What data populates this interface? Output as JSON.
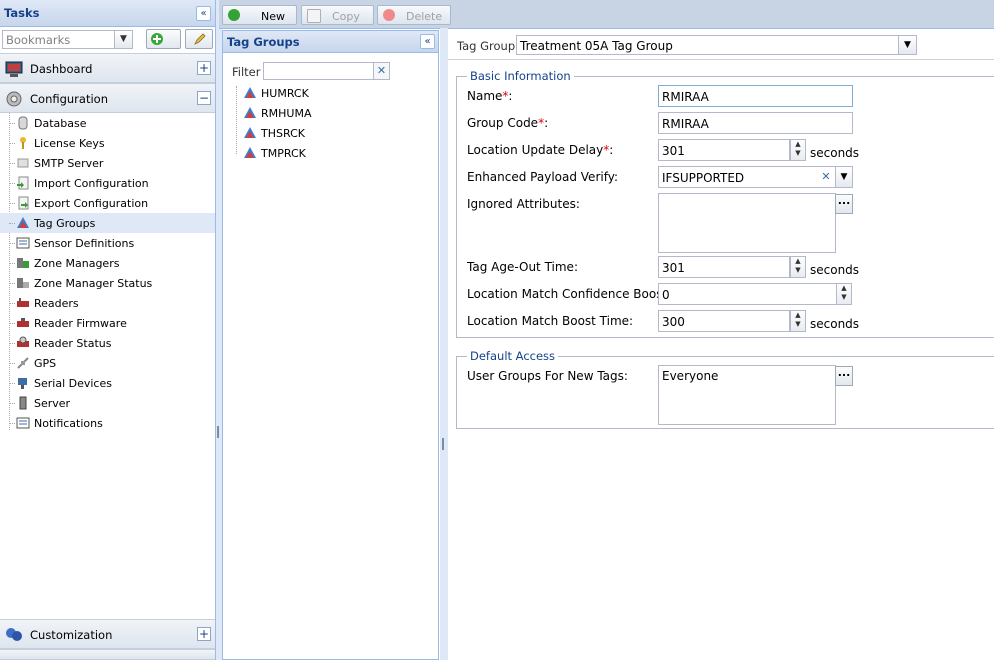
{
  "tasks": {
    "title": "Tasks",
    "bookmarks_placeholder": "Bookmarks",
    "sections": [
      {
        "label": "Dashboard",
        "toggle": "+"
      },
      {
        "label": "Configuration",
        "toggle": "−"
      },
      {
        "label": "Customization",
        "toggle": "+"
      }
    ],
    "config_items": [
      {
        "label": "Database",
        "icon": "database-icon"
      },
      {
        "label": "License Keys",
        "icon": "key-icon"
      },
      {
        "label": "SMTP Server",
        "icon": "smtp-server-icon"
      },
      {
        "label": "Import Configuration",
        "icon": "import-icon"
      },
      {
        "label": "Export Configuration",
        "icon": "export-icon"
      },
      {
        "label": "Tag Groups",
        "icon": "tag-group-icon"
      },
      {
        "label": "Sensor Definitions",
        "icon": "sensor-definitions-icon"
      },
      {
        "label": "Zone Managers",
        "icon": "zone-managers-icon"
      },
      {
        "label": "Zone Manager Status",
        "icon": "zone-manager-status-icon"
      },
      {
        "label": "Readers",
        "icon": "reader-icon"
      },
      {
        "label": "Reader Firmware",
        "icon": "reader-firmware-icon"
      },
      {
        "label": "Reader Status",
        "icon": "reader-status-icon"
      },
      {
        "label": "GPS",
        "icon": "gps-icon"
      },
      {
        "label": "Serial Devices",
        "icon": "serial-devices-icon"
      },
      {
        "label": "Server",
        "icon": "server-icon"
      },
      {
        "label": "Notifications",
        "icon": "notifications-icon"
      }
    ],
    "selected_item": "Tag Groups"
  },
  "toolbar": {
    "new_label": "New",
    "copy_label": "Copy",
    "delete_label": "Delete"
  },
  "tag_groups": {
    "title": "Tag Groups",
    "filter_label": "Filter",
    "filter_value": "",
    "items": [
      "HUMRCK",
      "RMHUMA",
      "THSRCK",
      "TMPRCK"
    ]
  },
  "form": {
    "tag_group_label": "Tag Group:",
    "tag_group_value": "Treatment 05A Tag Group",
    "basic_legend": "Basic Information",
    "name_label": "Name",
    "name_value": "RMIRAA",
    "group_code_label": "Group Code",
    "group_code_value": "RMIRAA",
    "location_update_delay_label": "Location Update Delay",
    "location_update_delay_value": "301",
    "location_update_delay_unit": "seconds",
    "enhanced_payload_label": "Enhanced Payload Verify:",
    "enhanced_payload_value": "IFSUPPORTED",
    "ignored_attributes_label": "Ignored Attributes:",
    "ignored_attributes_value": "",
    "tag_age_out_label": "Tag Age-Out Time:",
    "tag_age_out_value": "301",
    "tag_age_out_unit": "seconds",
    "confidence_boost_label": "Location Match Confidence Boost:",
    "confidence_boost_value": "0",
    "boost_time_label": "Location Match Boost Time:",
    "boost_time_value": "300",
    "boost_time_unit": "seconds",
    "default_access_legend": "Default Access",
    "user_groups_label": "User Groups For New Tags:",
    "user_groups_value": "Everyone",
    "required_marker": "*",
    "colon": ":"
  },
  "colors": {
    "header_blue": "#15428b",
    "border_blue": "#99bbe8",
    "selection": "#dfe8f6",
    "required_red": "#e00000"
  }
}
